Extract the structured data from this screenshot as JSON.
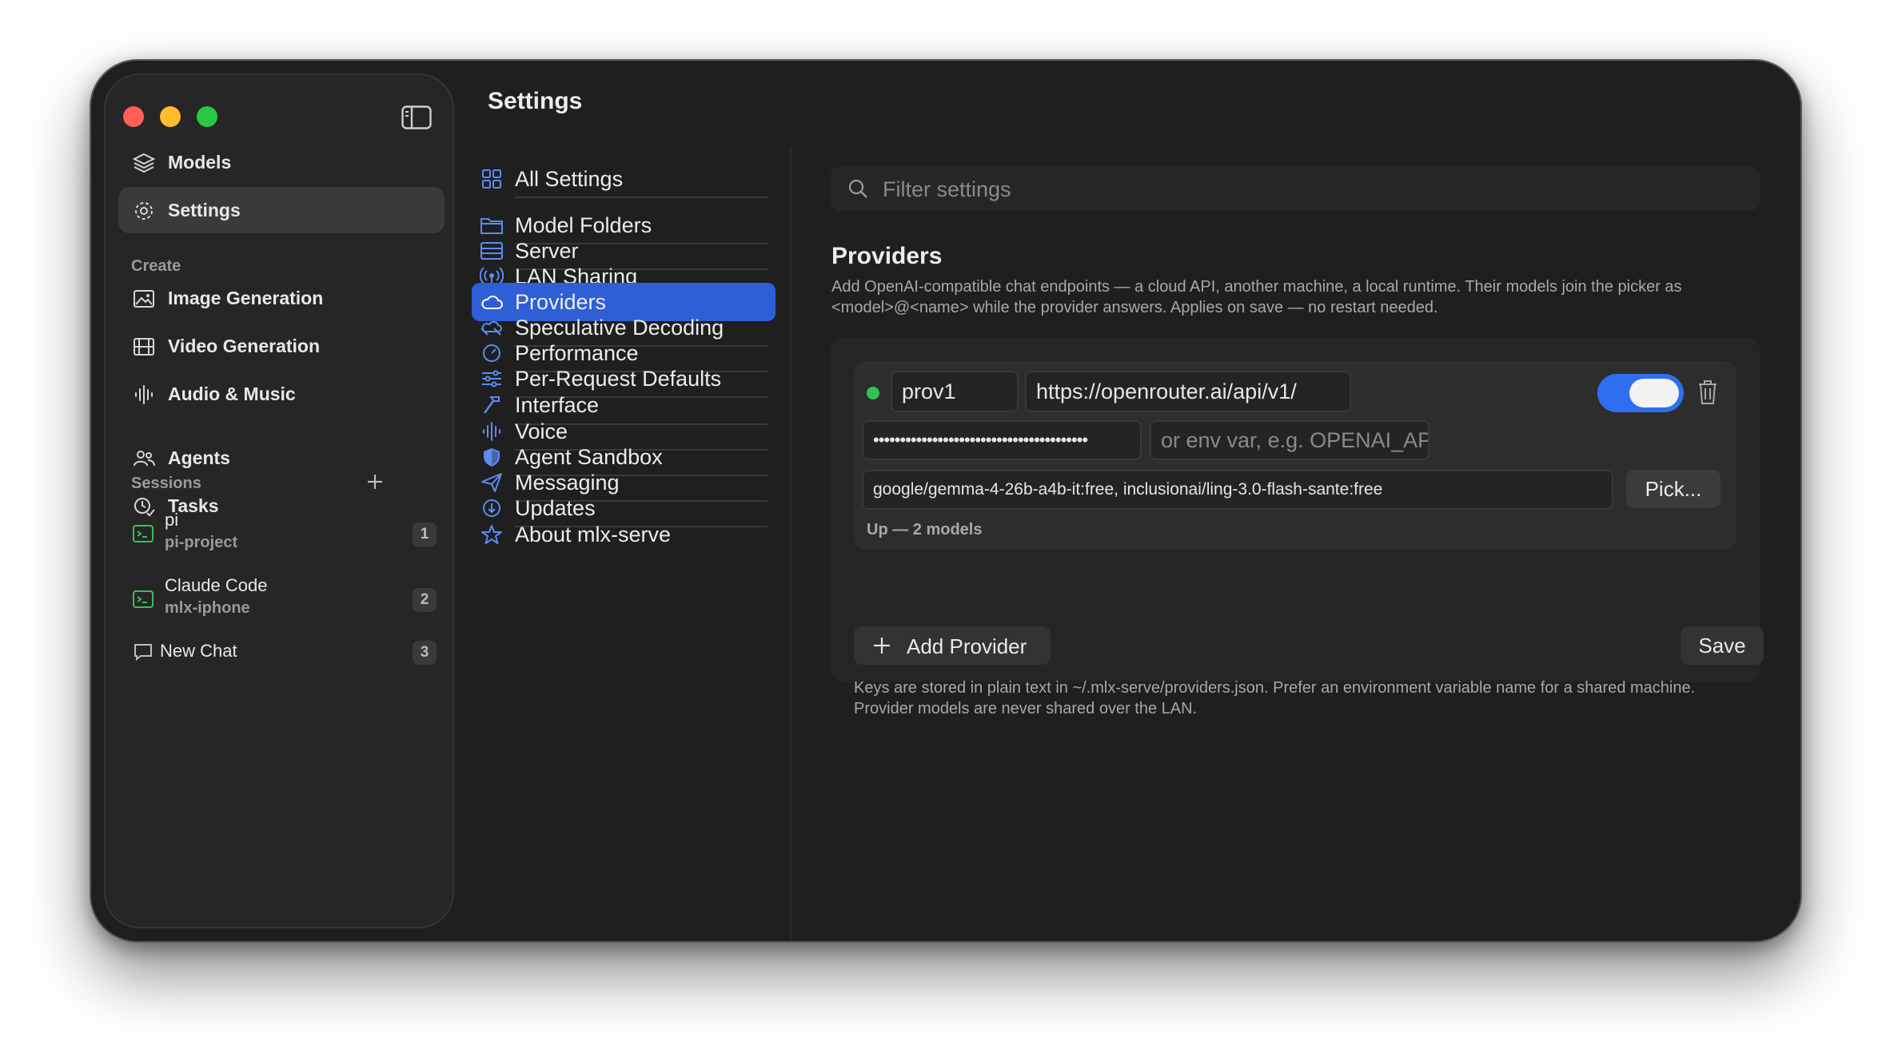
{
  "sidebar": {
    "main_items": [
      {
        "label": "Models",
        "icon": "layers-icon"
      },
      {
        "label": "Settings",
        "icon": "gear-icon"
      }
    ],
    "create_heading": "Create",
    "create_items": [
      {
        "label": "Image Generation",
        "icon": "image-icon"
      },
      {
        "label": "Video Generation",
        "icon": "film-icon"
      },
      {
        "label": "Audio & Music",
        "icon": "waveform-icon"
      }
    ],
    "extra_items": [
      {
        "label": "Agents",
        "icon": "people-icon"
      },
      {
        "label": "Tasks",
        "icon": "clock-check-icon"
      }
    ],
    "sessions_heading": "Sessions",
    "sessions": [
      {
        "title": "pi",
        "subtitle": "pi-project",
        "badge": "1",
        "icon": "terminal-icon"
      },
      {
        "title": "Claude Code",
        "subtitle": "mlx-iphone",
        "badge": "2",
        "icon": "terminal-icon"
      },
      {
        "title": "New Chat",
        "subtitle": "",
        "badge": "3",
        "icon": "chat-bubble-icon"
      }
    ]
  },
  "page_title": "Settings",
  "settings_nav": [
    {
      "label": "All Settings",
      "icon": "grid-icon"
    },
    {
      "label": "Model Folders",
      "icon": "folder-icon"
    },
    {
      "label": "Server",
      "icon": "server-icon"
    },
    {
      "label": "LAN Sharing",
      "icon": "broadcast-icon"
    },
    {
      "label": "Providers",
      "icon": "cloud-icon"
    },
    {
      "label": "Speculative Decoding",
      "icon": "speculative-icon"
    },
    {
      "label": "Performance",
      "icon": "gauge-icon"
    },
    {
      "label": "Per-Request Defaults",
      "icon": "sliders-icon"
    },
    {
      "label": "Interface",
      "icon": "hammer-icon"
    },
    {
      "label": "Voice",
      "icon": "waveform-icon"
    },
    {
      "label": "Agent Sandbox",
      "icon": "shield-icon"
    },
    {
      "label": "Messaging",
      "icon": "send-icon"
    },
    {
      "label": "Updates",
      "icon": "download-circle-icon"
    },
    {
      "label": "About mlx-serve",
      "icon": "star-icon"
    }
  ],
  "filter": {
    "placeholder": "Filter settings"
  },
  "providers": {
    "title": "Providers",
    "description": "Add OpenAI-compatible chat endpoints — a cloud API, another machine, a local runtime. Their models join the picker as <model>@<name> while the provider answers. Applies on save — no restart needed.",
    "entry": {
      "name": "prov1",
      "url": "https://openrouter.ai/api/v1/",
      "api_key_masked": "••••••••••••••••••••••••••••••••••••••••",
      "env_placeholder": "or env var, e.g. OPENAI_API_KEY",
      "models": "google/gemma-4-26b-a4b-it:free, inclusionai/ling-3.0-flash-sante:free",
      "pick_label": "Pick...",
      "status": "Up — 2 models",
      "enabled": true
    },
    "add_label": "Add Provider",
    "save_label": "Save",
    "note": "Keys are stored in plain text in ~/.mlx-serve/providers.json. Prefer an environment variable name for a shared machine. Provider models are never shared over the LAN."
  },
  "colors": {
    "accent": "#2f5fd6",
    "toggle_on": "#2f6ef0",
    "status_up": "#32c252"
  }
}
